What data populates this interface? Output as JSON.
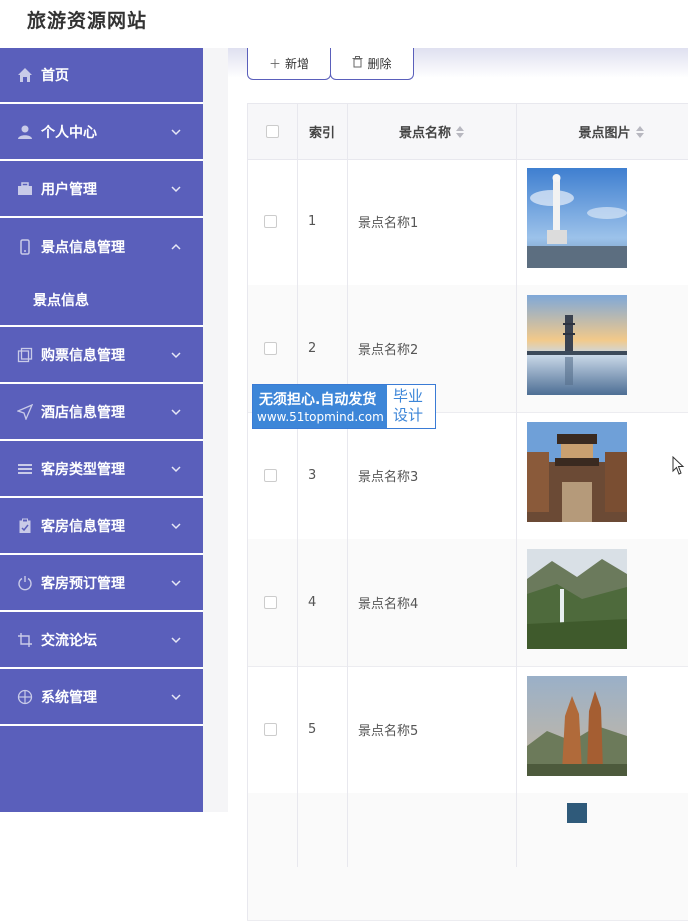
{
  "app": {
    "title": "旅游资源网站"
  },
  "sidebar": {
    "items": [
      {
        "label": "首页",
        "icon": "home-icon"
      },
      {
        "label": "个人中心",
        "icon": "user-icon"
      },
      {
        "label": "用户管理",
        "icon": "briefcase-icon"
      },
      {
        "label": "景点信息管理",
        "icon": "phone-icon"
      },
      {
        "label": "景点信息",
        "icon": ""
      },
      {
        "label": "购票信息管理",
        "icon": "copy-icon"
      },
      {
        "label": "酒店信息管理",
        "icon": "send-icon"
      },
      {
        "label": "客房类型管理",
        "icon": "list-icon"
      },
      {
        "label": "客房信息管理",
        "icon": "clipboard-icon"
      },
      {
        "label": "客房预订管理",
        "icon": "power-icon"
      },
      {
        "label": "交流论坛",
        "icon": "crop-icon"
      },
      {
        "label": "系统管理",
        "icon": "globe-icon"
      }
    ]
  },
  "toolbar": {
    "add_label": "新增",
    "delete_label": "删除"
  },
  "table": {
    "headers": {
      "index": "索引",
      "name": "景点名称",
      "image": "景点图片"
    },
    "rows": [
      {
        "index": "1",
        "name": "景点名称1"
      },
      {
        "index": "2",
        "name": "景点名称2"
      },
      {
        "index": "3",
        "name": "景点名称3"
      },
      {
        "index": "4",
        "name": "景点名称4"
      },
      {
        "index": "5",
        "name": "景点名称5"
      }
    ]
  },
  "watermark": {
    "line1": "无须担心.自动发货",
    "line2": "www.51topmind.com",
    "side": "毕业设计"
  },
  "colors": {
    "sidebar": "#5a5fbb",
    "accent": "#3d86d8"
  }
}
